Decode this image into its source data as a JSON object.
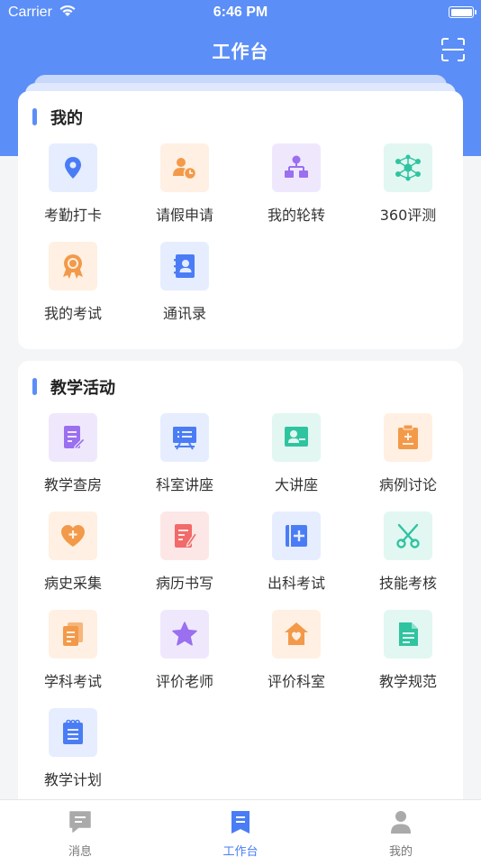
{
  "status_bar": {
    "carrier": "Carrier",
    "time": "6:46 PM"
  },
  "nav": {
    "title": "工作台"
  },
  "sections": [
    {
      "title": "我的",
      "items": [
        {
          "label": "考勤打卡",
          "icon": "location-pin-icon"
        },
        {
          "label": "请假申请",
          "icon": "user-clock-icon"
        },
        {
          "label": "我的轮转",
          "icon": "org-chart-icon"
        },
        {
          "label": "360评测",
          "icon": "network-icon"
        },
        {
          "label": "我的考试",
          "icon": "award-ribbon-icon"
        },
        {
          "label": "通讯录",
          "icon": "contact-book-icon"
        }
      ]
    },
    {
      "title": "教学活动",
      "items": [
        {
          "label": "教学查房",
          "icon": "document-edit-icon"
        },
        {
          "label": "科室讲座",
          "icon": "presentation-board-icon"
        },
        {
          "label": "大讲座",
          "icon": "lecturer-icon"
        },
        {
          "label": "病例讨论",
          "icon": "clipboard-plus-icon"
        },
        {
          "label": "病史采集",
          "icon": "heart-plus-icon"
        },
        {
          "label": "病历书写",
          "icon": "medical-record-pen-icon"
        },
        {
          "label": "出科考试",
          "icon": "notebook-plus-icon"
        },
        {
          "label": "技能考核",
          "icon": "scissors-icon"
        },
        {
          "label": "学科考试",
          "icon": "papers-icon"
        },
        {
          "label": "评价老师",
          "icon": "star-icon"
        },
        {
          "label": "评价科室",
          "icon": "house-heart-icon"
        },
        {
          "label": "教学规范",
          "icon": "document-lines-icon"
        },
        {
          "label": "教学计划",
          "icon": "spiral-notepad-icon"
        }
      ]
    }
  ],
  "tabbar": [
    {
      "label": "消息",
      "icon": "message-icon",
      "active": false
    },
    {
      "label": "工作台",
      "icon": "workbench-icon",
      "active": true
    },
    {
      "label": "我的",
      "icon": "profile-icon",
      "active": false
    }
  ],
  "colors": {
    "primary": "#5b8ef7",
    "tab_active": "#4a7df5",
    "tab_inactive": "#777777",
    "icon_blue_bg": "#e6edfe",
    "icon_orange_bg": "#fff0e3",
    "icon_purple_bg": "#efe8fd",
    "icon_green_bg": "#e2f7f2",
    "icon_red_bg": "#fde6e6"
  }
}
